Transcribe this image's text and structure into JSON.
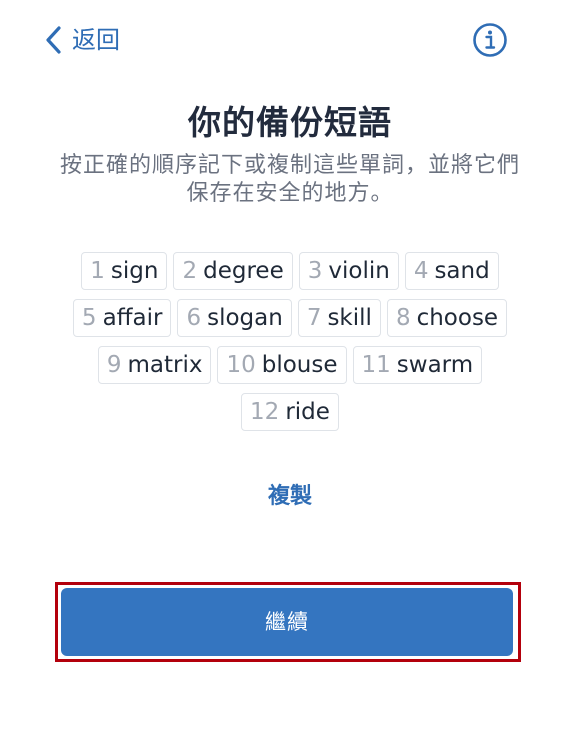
{
  "header": {
    "back_label": "返回",
    "back_icon": "chevron-left-icon",
    "info_icon": "info-circle-icon"
  },
  "title": "你的備份短語",
  "subtitle": "按正確的順序記下或複制這些單詞，並將它們保存在安全的地方。",
  "words": [
    {
      "num": "1",
      "word": "sign"
    },
    {
      "num": "2",
      "word": "degree"
    },
    {
      "num": "3",
      "word": "violin"
    },
    {
      "num": "4",
      "word": "sand"
    },
    {
      "num": "5",
      "word": "affair"
    },
    {
      "num": "6",
      "word": "slogan"
    },
    {
      "num": "7",
      "word": "skill"
    },
    {
      "num": "8",
      "word": "choose"
    },
    {
      "num": "9",
      "word": "matrix"
    },
    {
      "num": "10",
      "word": "blouse"
    },
    {
      "num": "11",
      "word": "swarm"
    },
    {
      "num": "12",
      "word": "ride"
    }
  ],
  "copy_label": "複製",
  "continue_label": "繼續",
  "colors": {
    "accent": "#2f6db5",
    "button": "#3475c0",
    "highlight": "#b3000c"
  }
}
